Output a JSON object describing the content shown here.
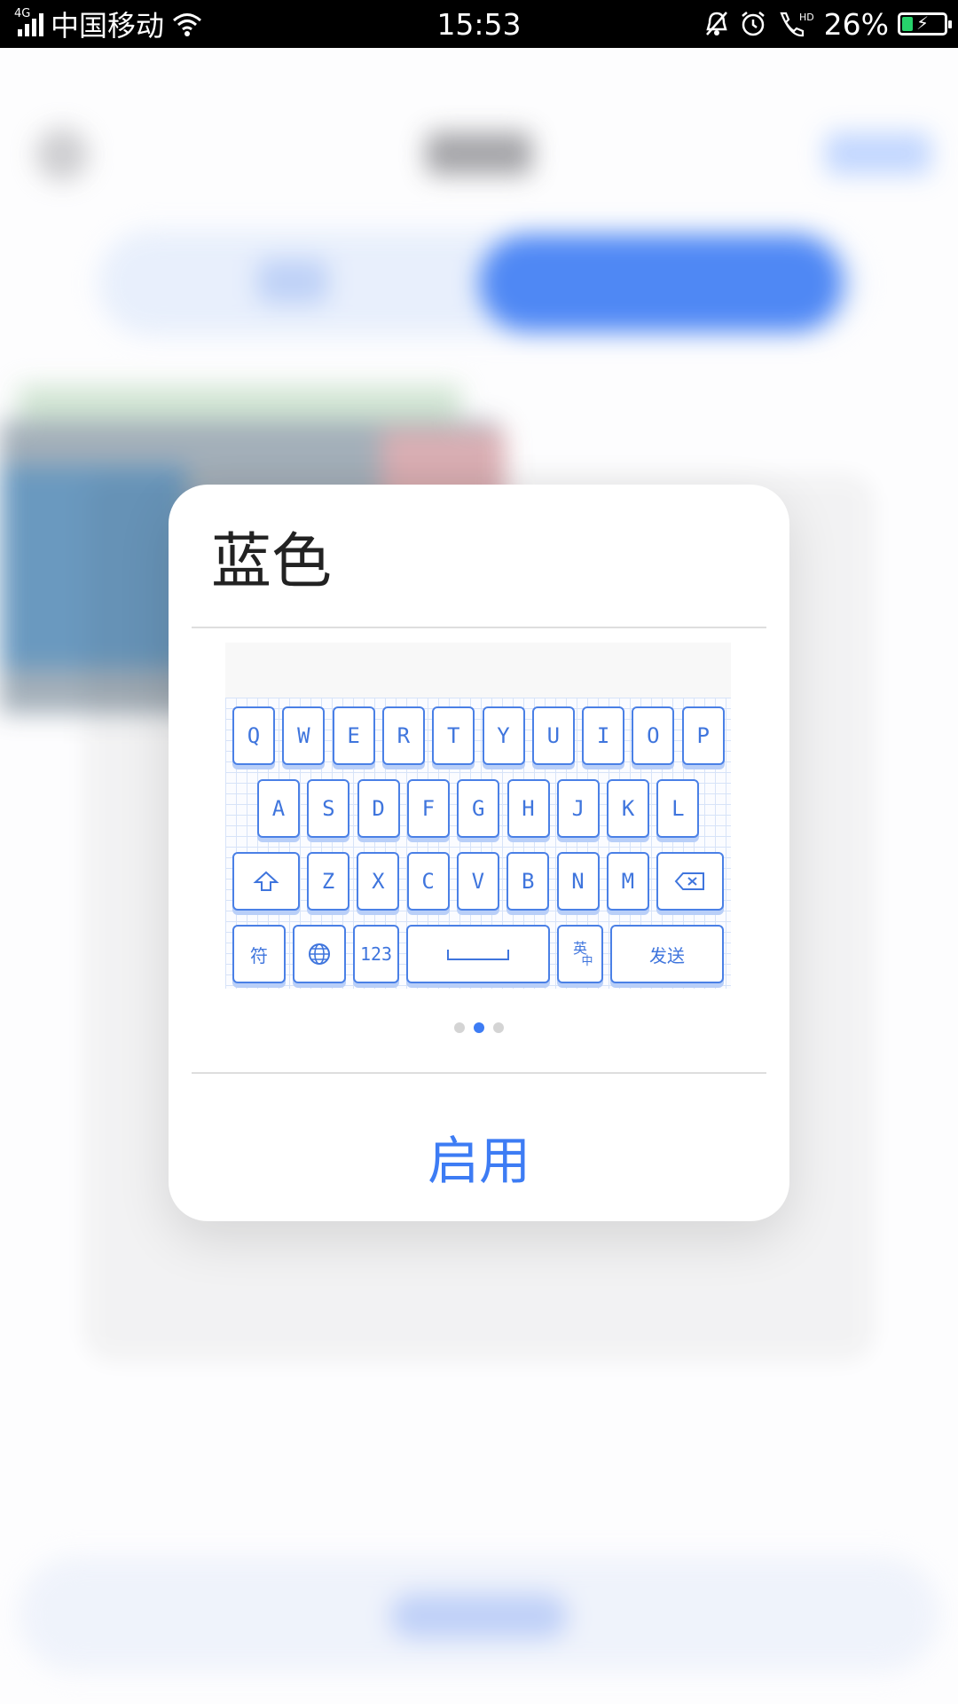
{
  "status_bar": {
    "network_type": "4G",
    "carrier": "中国移动",
    "time": "15:53",
    "battery_percent": "26%",
    "battery_level": 0.26
  },
  "dialog": {
    "title": "蓝色",
    "enable_label": "启用",
    "page_dots": {
      "count": 3,
      "active_index": 1
    },
    "keyboard": {
      "row1": [
        "Q",
        "W",
        "E",
        "R",
        "T",
        "Y",
        "U",
        "I",
        "O",
        "P"
      ],
      "row2": [
        "A",
        "S",
        "D",
        "F",
        "G",
        "H",
        "J",
        "K",
        "L"
      ],
      "row3": [
        "Z",
        "X",
        "C",
        "V",
        "B",
        "N",
        "M"
      ],
      "symbols_key": "符",
      "numbers_key": "123",
      "lang_key_top": "英",
      "lang_key_bottom": "中",
      "send_key": "发送",
      "accent_color": "#3d7cf4"
    }
  },
  "colors": {
    "accent": "#3d7cf4",
    "status_bar_bg": "#000000",
    "battery_fill": "#27d36b"
  }
}
